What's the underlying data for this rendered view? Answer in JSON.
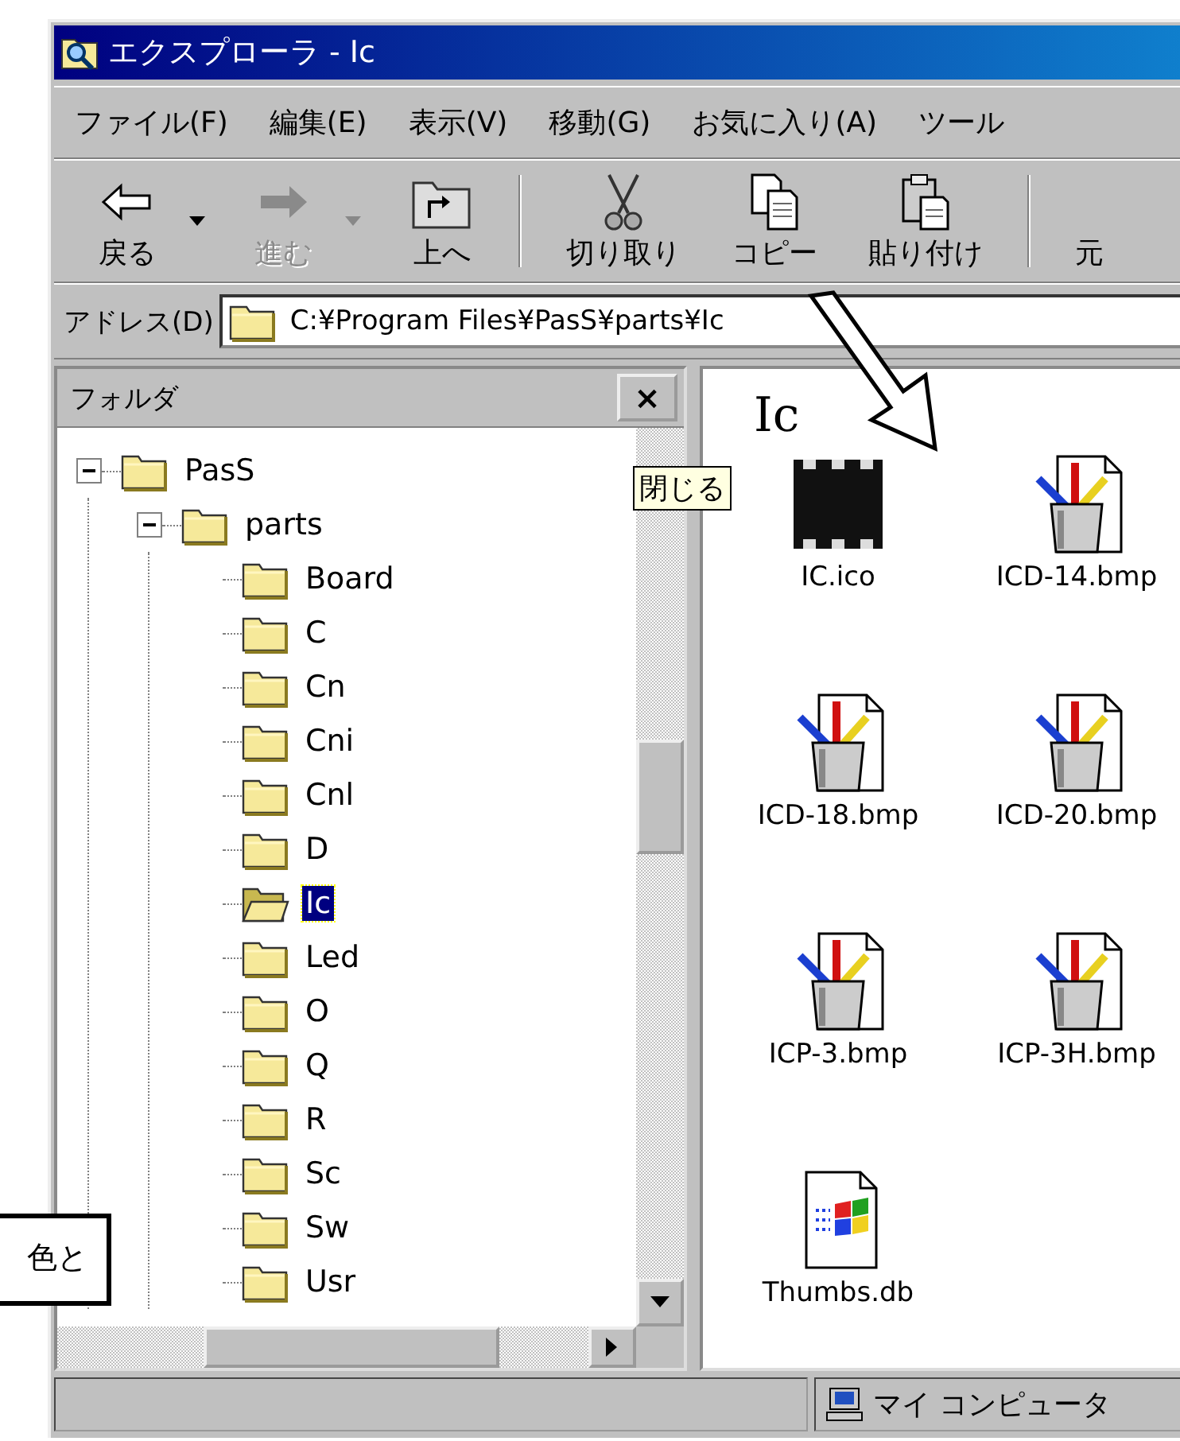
{
  "window": {
    "title": "エクスプローラ - Ic"
  },
  "menu": [
    {
      "label": "ファイル(F)"
    },
    {
      "label": "編集(E)"
    },
    {
      "label": "表示(V)"
    },
    {
      "label": "移動(G)"
    },
    {
      "label": "お気に入り(A)"
    },
    {
      "label": "ツール"
    }
  ],
  "toolbar": [
    {
      "label": "戻る",
      "kind": "back",
      "disabled": false,
      "dropdown": true,
      "separator_before": false
    },
    {
      "label": "進む",
      "kind": "forward",
      "disabled": true,
      "dropdown": true,
      "separator_before": false
    },
    {
      "label": "上へ",
      "kind": "up",
      "disabled": false,
      "dropdown": false,
      "separator_before": false
    },
    {
      "label": "切り取り",
      "kind": "cut",
      "disabled": false,
      "dropdown": false,
      "separator_before": true
    },
    {
      "label": "コピー",
      "kind": "copy",
      "disabled": false,
      "dropdown": false,
      "separator_before": false
    },
    {
      "label": "貼り付け",
      "kind": "paste",
      "disabled": false,
      "dropdown": false,
      "separator_before": false
    },
    {
      "label": "元",
      "kind": "blank",
      "disabled": false,
      "dropdown": false,
      "separator_before": true
    }
  ],
  "address": {
    "label": "アドレス(D)",
    "value": "C:¥Program Files¥PasS¥parts¥Ic"
  },
  "folders_pane": {
    "title": "フォルダ",
    "close_label": "×",
    "tooltip": "閉じる",
    "tree": [
      {
        "name": "PasS",
        "expanded": true,
        "selected": false,
        "children": [
          {
            "name": "parts",
            "expanded": true,
            "selected": false,
            "children": [
              {
                "name": "Board",
                "selected": false
              },
              {
                "name": "C",
                "selected": false
              },
              {
                "name": "Cn",
                "selected": false
              },
              {
                "name": "Cni",
                "selected": false
              },
              {
                "name": "Cnl",
                "selected": false
              },
              {
                "name": "D",
                "selected": false
              },
              {
                "name": "Ic",
                "selected": true
              },
              {
                "name": "Led",
                "selected": false
              },
              {
                "name": "O",
                "selected": false
              },
              {
                "name": "Q",
                "selected": false
              },
              {
                "name": "R",
                "selected": false
              },
              {
                "name": "Sc",
                "selected": false
              },
              {
                "name": "Sw",
                "selected": false
              },
              {
                "name": "Usr",
                "selected": false
              }
            ]
          }
        ]
      }
    ]
  },
  "content": {
    "title": "Ic",
    "files": [
      {
        "name": "IC.ico",
        "kind": "chip"
      },
      {
        "name": "ICD-14.bmp",
        "kind": "bitmap"
      },
      {
        "name": "ICD-18.bmp",
        "kind": "bitmap"
      },
      {
        "name": "ICD-20.bmp",
        "kind": "bitmap"
      },
      {
        "name": "ICP-3.bmp",
        "kind": "bitmap"
      },
      {
        "name": "ICP-3H.bmp",
        "kind": "bitmap"
      },
      {
        "name": "Thumbs.db",
        "kind": "system"
      }
    ]
  },
  "status_bar": {
    "location": "マイ コンピュータ"
  },
  "annotation": {
    "callout": "色と"
  }
}
